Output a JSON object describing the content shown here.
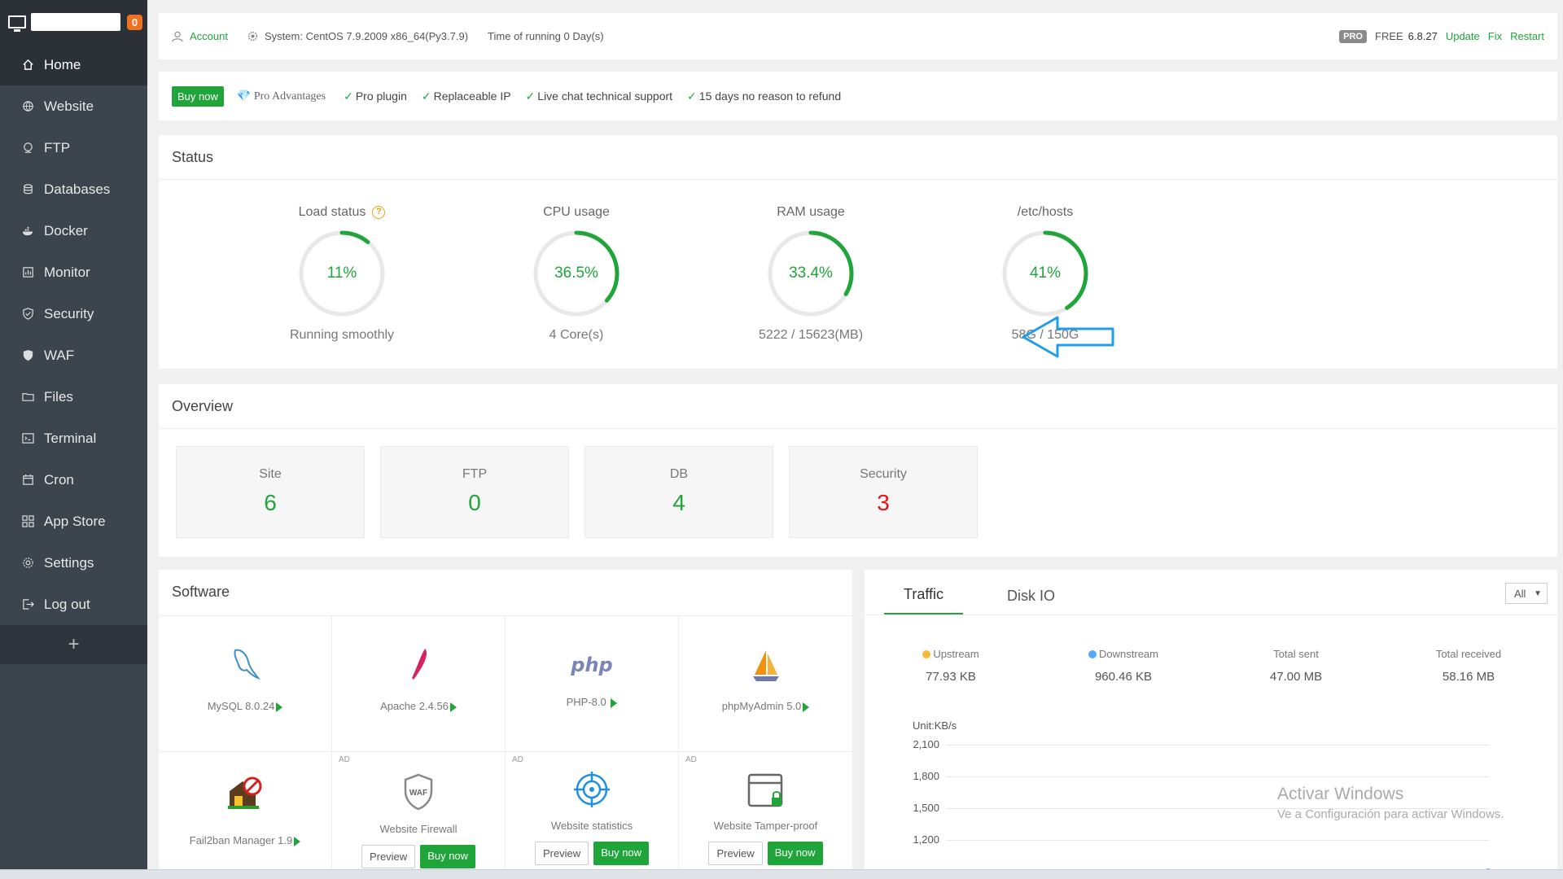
{
  "sidebar": {
    "badge": "0",
    "items": [
      {
        "label": "Home",
        "icon": "home-icon"
      },
      {
        "label": "Website",
        "icon": "globe-icon"
      },
      {
        "label": "FTP",
        "icon": "ftp-icon"
      },
      {
        "label": "Databases",
        "icon": "database-icon"
      },
      {
        "label": "Docker",
        "icon": "docker-icon"
      },
      {
        "label": "Monitor",
        "icon": "monitor-icon"
      },
      {
        "label": "Security",
        "icon": "shield-icon"
      },
      {
        "label": "WAF",
        "icon": "waf-icon"
      },
      {
        "label": "Files",
        "icon": "folder-icon"
      },
      {
        "label": "Terminal",
        "icon": "terminal-icon"
      },
      {
        "label": "Cron",
        "icon": "calendar-icon"
      },
      {
        "label": "App Store",
        "icon": "grid-icon"
      },
      {
        "label": "Settings",
        "icon": "gear-icon"
      },
      {
        "label": "Log out",
        "icon": "logout-icon"
      }
    ],
    "plus": "+"
  },
  "topbar": {
    "account": "Account",
    "system_label": "System:",
    "system_value": "CentOS 7.9.2009 x86_64(Py3.7.9)",
    "running": "Time of running 0 Day(s)",
    "pro": "PRO",
    "free": "FREE",
    "version": "6.8.27",
    "update": "Update",
    "fix": "Fix",
    "restart": "Restart"
  },
  "promo": {
    "buy": "Buy now",
    "advantages": "Pro Advantages",
    "features": [
      "Pro plugin",
      "Replaceable IP",
      "Live chat technical support",
      "15 days no reason to refund"
    ]
  },
  "status": {
    "title": "Status",
    "gauges": [
      {
        "label": "Load status",
        "value": "11%",
        "percent": 11,
        "sub": "Running smoothly"
      },
      {
        "label": "CPU usage",
        "value": "36.5%",
        "percent": 36.5,
        "sub": "4 Core(s)"
      },
      {
        "label": "RAM usage",
        "value": "33.4%",
        "percent": 33.4,
        "sub": "5222 / 15623(MB)"
      },
      {
        "label": "/etc/hosts",
        "value": "41%",
        "percent": 41,
        "sub": "58G / 150G"
      }
    ]
  },
  "overview": {
    "title": "Overview",
    "cards": [
      {
        "label": "Site",
        "value": "6"
      },
      {
        "label": "FTP",
        "value": "0"
      },
      {
        "label": "DB",
        "value": "4"
      },
      {
        "label": "Security",
        "value": "3"
      }
    ]
  },
  "software": {
    "title": "Software",
    "installed": [
      "MySQL 8.0.24",
      "Apache 2.4.56",
      "PHP-8.0",
      "phpMyAdmin 5.0"
    ],
    "fail2ban": "Fail2ban Manager 1.9",
    "ad": "AD",
    "ads": [
      "Website Firewall",
      "Website statistics",
      "Website Tamper-proof"
    ],
    "waf_text": "WAF",
    "php_logo": "php",
    "preview": "Preview",
    "buy": "Buy now"
  },
  "traffic": {
    "tabs": [
      "Traffic",
      "Disk IO"
    ],
    "select": "All",
    "stats": [
      {
        "label": "Upstream",
        "value": "77.93 KB"
      },
      {
        "label": "Downstream",
        "value": "960.46 KB"
      },
      {
        "label": "Total sent",
        "value": "47.00 MB"
      },
      {
        "label": "Total received",
        "value": "58.16 MB"
      }
    ],
    "unit": "Unit:KB/s",
    "yticks": [
      "2,100",
      "1,800",
      "1,500",
      "1,200"
    ],
    "colors": {
      "upstream": "#f6b93b",
      "downstream": "#52a9ff"
    }
  },
  "watermark": {
    "line1": "Activar Windows",
    "line2": "Ve a Configuración para activar Windows."
  },
  "colors": {
    "accent": "#20a53a",
    "sidebar": "#3c444d",
    "danger": "#e81414"
  }
}
